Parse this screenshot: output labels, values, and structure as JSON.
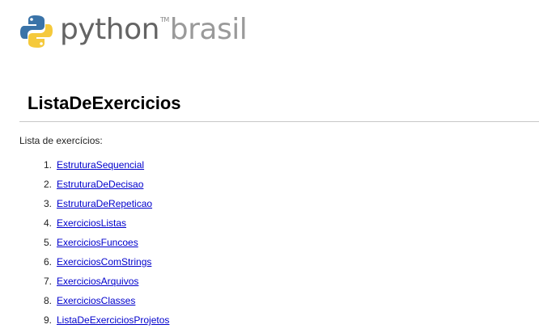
{
  "logo": {
    "python": "python",
    "tm": "TM",
    "brasil": "brasil"
  },
  "page_title": "ListaDeExercicios",
  "intro": "Lista de exercícios:",
  "items": [
    {
      "num": "1.",
      "label": "EstruturaSequencial"
    },
    {
      "num": "2.",
      "label": "EstruturaDeDecisao"
    },
    {
      "num": "3.",
      "label": "EstruturaDeRepeticao"
    },
    {
      "num": "4.",
      "label": "ExerciciosListas"
    },
    {
      "num": "5.",
      "label": "ExerciciosFuncoes"
    },
    {
      "num": "6.",
      "label": "ExerciciosComStrings"
    },
    {
      "num": "7.",
      "label": "ExerciciosArquivos"
    },
    {
      "num": "8.",
      "label": "ExerciciosClasses"
    },
    {
      "num": "9.",
      "label": "ListaDeExerciciosProjetos"
    }
  ],
  "colors": {
    "link": "#0000cc",
    "python_blue": "#3a73a8",
    "python_yellow": "#f5c93b"
  }
}
